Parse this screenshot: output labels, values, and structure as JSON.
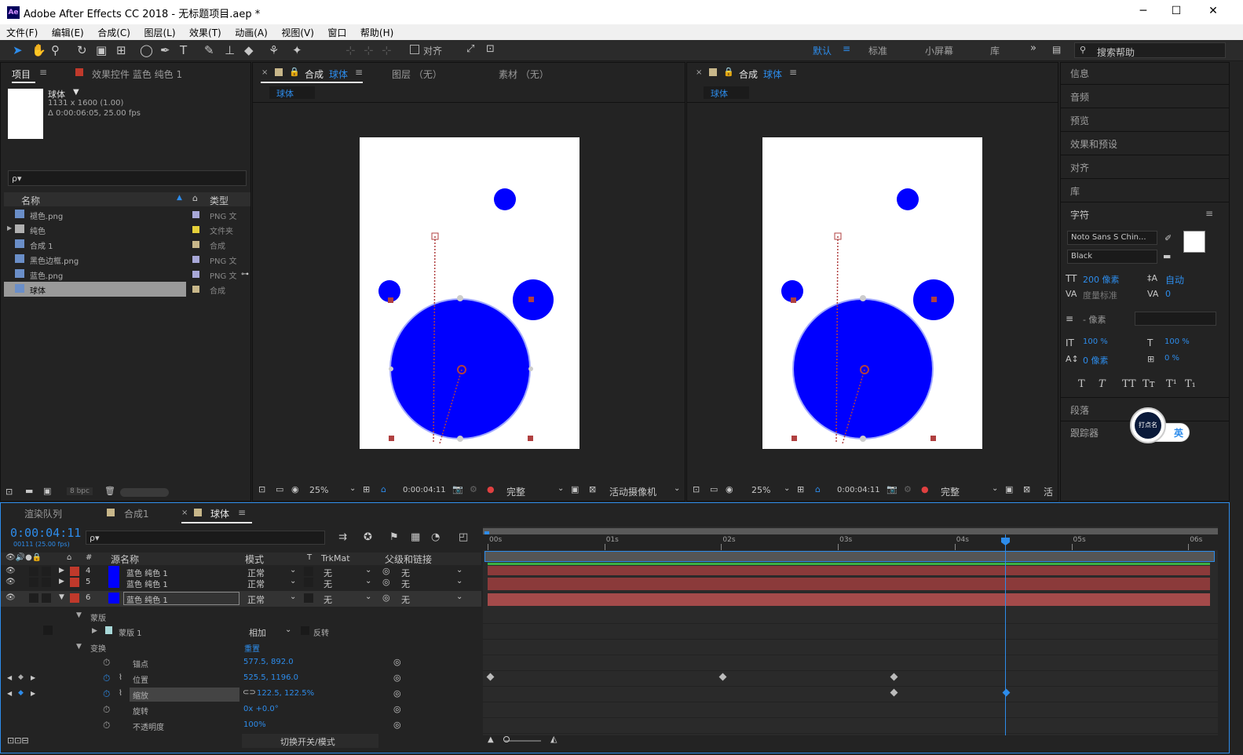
{
  "window": {
    "title": "Adobe After Effects CC 2018 - 无标题项目.aep *",
    "icon_label": "Ae",
    "min": "─",
    "max": "☐",
    "close": "✕"
  },
  "menu": [
    "文件(F)",
    "编辑(E)",
    "合成(C)",
    "图层(L)",
    "效果(T)",
    "动画(A)",
    "视图(V)",
    "窗口",
    "帮助(H)"
  ],
  "toolbar": {
    "align_label": "对齐",
    "workspaces": [
      "默认",
      "标准",
      "小屏幕",
      "库"
    ],
    "search_placeholder": "搜索帮助"
  },
  "project": {
    "tab_label": "项目",
    "effects_tab": "效果控件 蓝色 纯色 1",
    "selected_name": "球体",
    "selected_dims": "1131 x 1600 (1.00)",
    "selected_duration": "Δ 0:00:06:05, 25.00 fps",
    "search_placeholder": "ρ▾",
    "col_name": "名称",
    "col_type": "类型",
    "items": [
      {
        "name": "褪色.png",
        "type": "PNG 文件",
        "color": "#a8a8d8"
      },
      {
        "name": "纯色",
        "type": "文件夹",
        "color": "#e6d13a"
      },
      {
        "name": "合成 1",
        "type": "合成",
        "color": "#c8b78a"
      },
      {
        "name": "黑色边框.png",
        "type": "PNG 文件",
        "color": "#a8a8d8"
      },
      {
        "name": "蓝色.png",
        "type": "PNG 文件",
        "color": "#a8a8d8"
      },
      {
        "name": "球体",
        "type": "合成",
        "color": "#c8b78a"
      }
    ],
    "bpc": "8 bpc"
  },
  "viewer1": {
    "tab_prefix": "合成",
    "tab_name": "球体",
    "layer_tab": "图层 （无）",
    "footage_tab": "素材 （无）",
    "subtab": "球体",
    "zoom": "25%",
    "time": "0:00:04:11",
    "quality": "完整",
    "camera": "活动摄像机"
  },
  "viewer2": {
    "tab_prefix": "合成",
    "tab_name": "球体",
    "subtab": "球体",
    "zoom": "25%",
    "time": "0:00:04:11",
    "quality": "完整",
    "camera": "活"
  },
  "right_panel": {
    "items": [
      "信息",
      "音频",
      "预览",
      "效果和预设",
      "对齐",
      "库"
    ],
    "char_title": "字符",
    "font": "Noto Sans S Chin...",
    "style": "Black",
    "size": "200 像素",
    "leading": "自动",
    "kerning": "度量标准",
    "tracking": "0",
    "indent": "- 像素",
    "vscale": "100 %",
    "hscale": "100 %",
    "baseline": "0 像素",
    "tsume": "0 %",
    "styles": [
      "T",
      "T",
      "TT",
      "Tт",
      "T¹",
      "T₁"
    ],
    "para": "段落",
    "tracker": "跟踪器",
    "ime_label": "英",
    "ime_icon": "打点名"
  },
  "timeline": {
    "tabs": [
      "渲染队列",
      "合成1",
      "球体"
    ],
    "timecode": "0:00:04:11",
    "fps_label": "00111 (25.00 fps)",
    "cols": {
      "src": "源名称",
      "mode": "模式",
      "t": "T",
      "trkmat": "TrkMat",
      "parent": "父级和链接"
    },
    "ruler": [
      "00s",
      "01s",
      "02s",
      "03s",
      "04s",
      "05s",
      "06s"
    ],
    "layers": [
      {
        "num": "4",
        "name": "蓝色 纯色 1",
        "mode": "正常",
        "trk": "无",
        "parent": "无"
      },
      {
        "num": "5",
        "name": "蓝色 纯色 1",
        "mode": "正常",
        "trk": "无",
        "parent": "无"
      },
      {
        "num": "6",
        "name": "蓝色 纯色 1",
        "mode": "正常",
        "trk": "无",
        "parent": "无"
      }
    ],
    "mask_group": "蒙版",
    "mask": "蒙版 1",
    "mask_mode": "相加",
    "mask_invert": "反转",
    "transform": "变换",
    "reset": "重置",
    "props": [
      {
        "name": "锚点",
        "value": "577.5, 892.0"
      },
      {
        "name": "位置",
        "value": "525.5, 1196.0"
      },
      {
        "name": "缩放",
        "value": "122.5, 122.5%"
      },
      {
        "name": "旋转",
        "value": "0x +0.0°"
      },
      {
        "name": "不透明度",
        "value": "100%"
      }
    ],
    "toggle_label": "切换开关/模式"
  },
  "colors": {
    "accent": "#2d8ceb",
    "ball": "#0000ff",
    "layer_red": "#c0392b",
    "track": "#8b3a3a"
  }
}
